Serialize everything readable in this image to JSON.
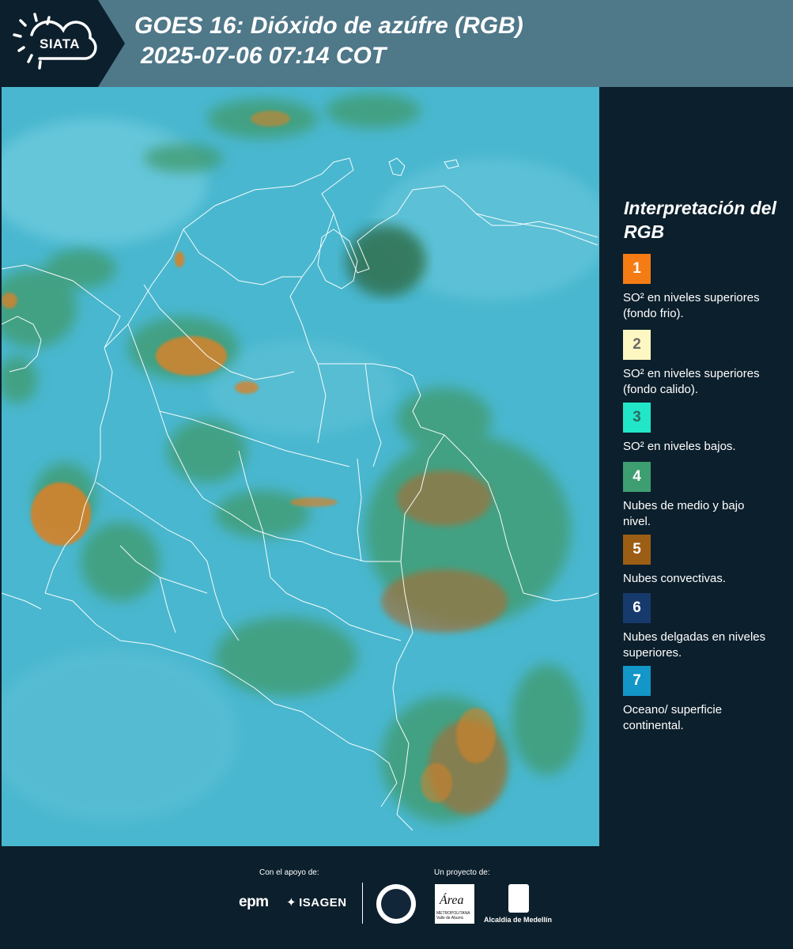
{
  "header": {
    "logo_text": "SIATA",
    "title_line1": "GOES 16: Dióxido de azúfre (RGB)",
    "title_line2": "2025-07-06 07:14 COT"
  },
  "legend": {
    "title": "Interpretación del RGB",
    "items": [
      {
        "number": "1",
        "color": "#f57c14",
        "label": "SO² en niveles superiores (fondo frio)."
      },
      {
        "number": "2",
        "color": "#fff7c2",
        "label": "SO² en niveles superiores (fondo calido)."
      },
      {
        "number": "3",
        "color": "#22e6c8",
        "label": "SO² en niveles bajos."
      },
      {
        "number": "4",
        "color": "#3d9e72",
        "label": "Nubes de medio y bajo nivel."
      },
      {
        "number": "5",
        "color": "#9c5e14",
        "label": "Nubes convectivas."
      },
      {
        "number": "6",
        "color": "#173a6c",
        "label": "Nubes delgadas en niveles superiores."
      },
      {
        "number": "7",
        "color": "#1396c8",
        "label": "Oceano/ superficie continental."
      }
    ]
  },
  "footer": {
    "support_label": "Con el apoyo de:",
    "project_label": "Un proyecto de:",
    "epm": "epm",
    "isagen": "ISAGEN",
    "area": "Área",
    "area_sub": "METROPOLITANA Valle de Aburrá",
    "alcaldia": "Alcaldía de Medellín"
  },
  "colors": {
    "background": "#0c1f2c",
    "header_bar": "#4f7889",
    "ocean_rgb": "#49b7cf",
    "cloud_green": "#3f9a6a",
    "convective_orange": "#d5822a"
  }
}
